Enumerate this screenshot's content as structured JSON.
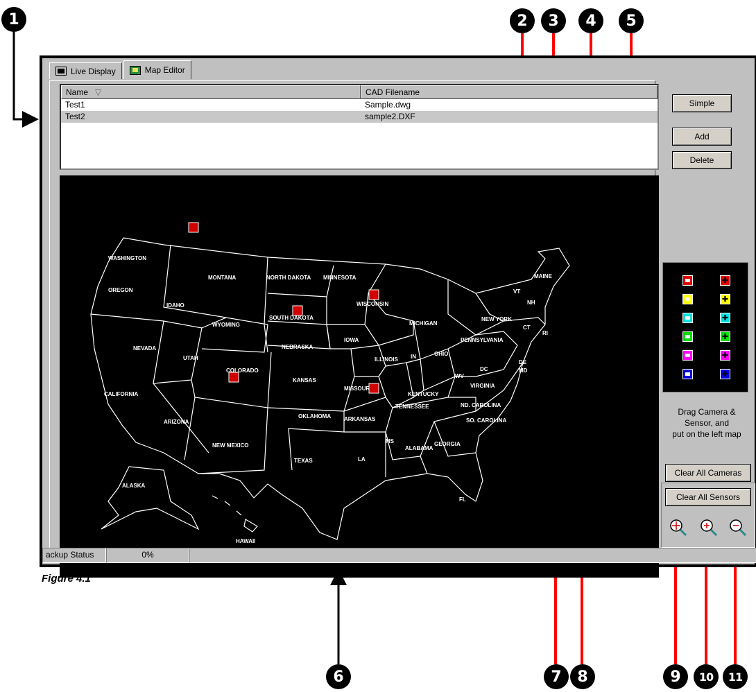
{
  "callouts": [
    "1",
    "2",
    "3",
    "4",
    "5",
    "6",
    "7",
    "8",
    "9",
    "10",
    "11"
  ],
  "tabs": [
    {
      "label": "Live Display",
      "icon": "monitor-icon"
    },
    {
      "label": "Map Editor",
      "icon": "map-icon"
    }
  ],
  "list": {
    "columns": [
      "Name",
      "CAD Filename"
    ],
    "sort_indicator": "▽",
    "rows": [
      {
        "name": "Test1",
        "file": "Sample.dwg"
      },
      {
        "name": "Test2",
        "file": "sample2.DXF"
      }
    ]
  },
  "buttons": {
    "simple": "Simple",
    "add": "Add",
    "delete": "Delete",
    "clear_cameras": "Clear All Cameras",
    "clear_sensors": "Clear All Sensors"
  },
  "hint": {
    "line1": "Drag Camera &",
    "line2": "Sensor, and",
    "line3": "put on the left map"
  },
  "palette": {
    "colors": [
      "#e00000",
      "#ffff00",
      "#00e0e0",
      "#00e000",
      "#ff00ff",
      "#0000e0"
    ]
  },
  "zoom_icons": [
    "zoom-fit-icon",
    "zoom-in-icon",
    "zoom-out-icon"
  ],
  "status": {
    "label": "ackup Status",
    "value": "0%"
  },
  "caption": "Figure 4.1",
  "map": {
    "states": [
      "WASHINGTON",
      "OREGON",
      "CALIFORNIA",
      "NEVADA",
      "IDAHO",
      "MONTANA",
      "WYOMING",
      "UTAH",
      "ARIZONA",
      "COLORADO",
      "NEW MEXICO",
      "NORTH DAKOTA",
      "SOUTH DAKOTA",
      "NEBRASKA",
      "KANSAS",
      "OKLAHOMA",
      "TEXAS",
      "MINNESOTA",
      "IOWA",
      "MISSOURI",
      "ARKANSAS",
      "LA",
      "WISCONSIN",
      "ILLINOIS",
      "IN",
      "OHIO",
      "MICHIGAN",
      "KENTUCKY",
      "TENNESSEE",
      "MS",
      "ALABAMA",
      "GEORGIA",
      "FL",
      "SO. CAROLINA",
      "ND. CAROLINA",
      "VIRGINIA",
      "WV",
      "PENNSYLVANIA",
      "NEW YORK",
      "VT",
      "NH",
      "MAINE",
      "CT",
      "RI",
      "DE",
      "MD",
      "DC",
      "ALASKA",
      "HAWAII"
    ]
  }
}
